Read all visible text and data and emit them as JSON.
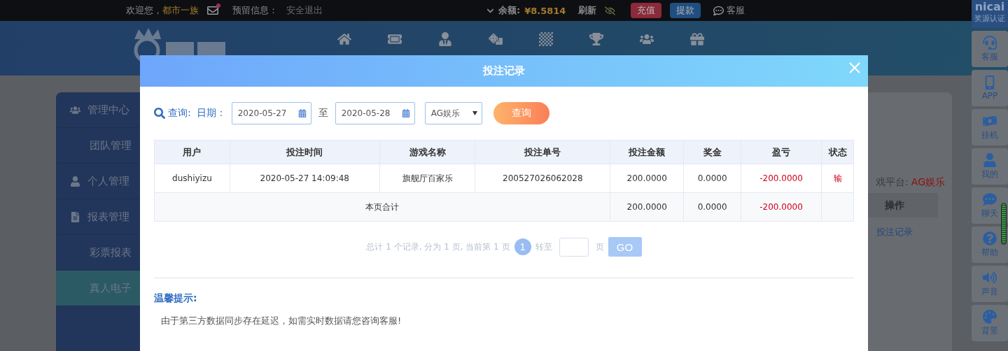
{
  "top_bar": {
    "welcome": "欢迎您，",
    "username": "都市一族",
    "mail_unread": true,
    "reserved": "预留信息：",
    "logout": "安全退出",
    "balance_label": "余额:",
    "balance": "¥8.5814",
    "refresh": "刷新",
    "deposit": "充值",
    "withdraw": "提款",
    "service": "客服"
  },
  "sidebar": {
    "items": [
      {
        "label": "管理中心",
        "kind": "section",
        "selected": false
      },
      {
        "label": "团队管理",
        "kind": "sub",
        "selected": false
      },
      {
        "label": "个人管理",
        "kind": "section",
        "selected": false
      },
      {
        "label": "报表管理",
        "kind": "section",
        "selected": false
      },
      {
        "label": "彩票报表",
        "kind": "sub",
        "selected": false
      },
      {
        "label": "真人电子",
        "kind": "sub",
        "selected": true
      }
    ]
  },
  "background_panel": {
    "platform_label": "戏平台:",
    "platform": "AG娱乐",
    "column": "操作",
    "link": "投注记录"
  },
  "right_dock": {
    "brand": "nicai",
    "brand_sub": "奖源认证",
    "items": [
      "客服",
      "APP",
      "挂机",
      "我的",
      "聊天",
      "帮助",
      "声音",
      "背景"
    ]
  },
  "modal": {
    "title": "投注记录",
    "filters": {
      "query_label": "查询:",
      "date_label": "日期：",
      "start_date": "2020-05-27",
      "to": "至",
      "end_date": "2020-05-28",
      "platform": "AG娱乐",
      "search_button": "查询"
    },
    "columns": [
      "用户",
      "投注时间",
      "游戏名称",
      "投注单号",
      "投注金额",
      "奖金",
      "盈亏",
      "状态"
    ],
    "rows": [
      [
        "dushiyizu",
        "2020-05-27 14:09:48",
        "旗舰厅百家乐",
        "200527026062028",
        "200.0000",
        "0.0000",
        "-200.0000",
        "输"
      ]
    ],
    "summary": {
      "label": "本页合计",
      "amount": "200.0000",
      "bonus": "0.0000",
      "profit": "-200.0000"
    },
    "pagination": {
      "summary": "总计 1 个记录, 分为 1 页, 当前第 1 页",
      "pages": [
        {
          "label": "1",
          "selected": true
        }
      ],
      "goto": "转至",
      "unit": "页",
      "go": "GO"
    },
    "notice": {
      "title": "温馨提示:",
      "text": "由于第三方数据同步存在延迟，如需实时数据请您咨询客服!"
    }
  }
}
